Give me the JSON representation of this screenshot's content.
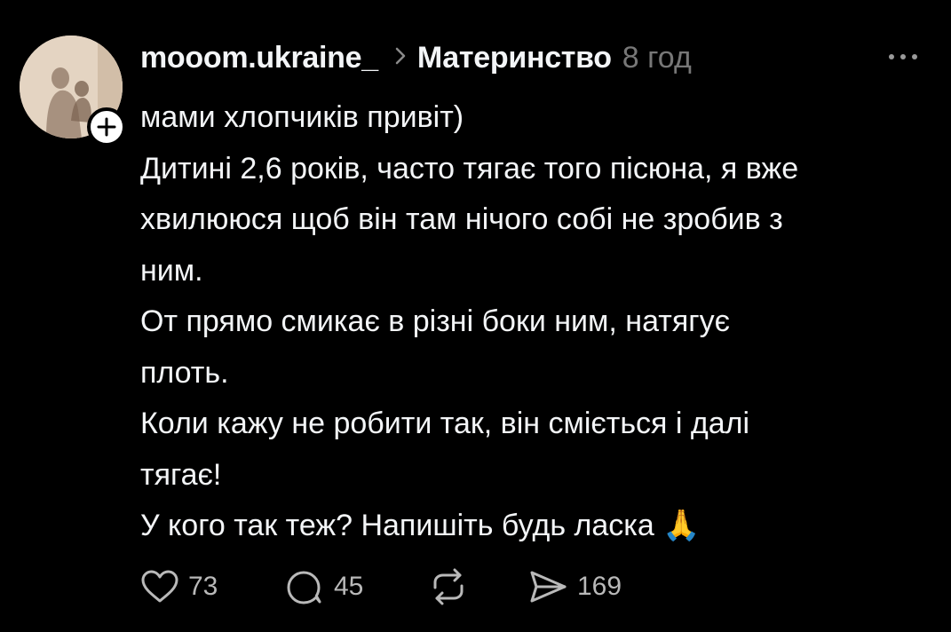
{
  "post": {
    "username": "mooom.ukraine_",
    "topic": "Материнство",
    "time": "8 год",
    "lines": [
      "мами хлопчиків привіт)",
      "Дитині 2,6 років, часто тягає того пісюна, я вже",
      "хвилююся щоб він там нічого собі не зробив з",
      "ним.",
      "От прямо смикає в різні боки ним, натягує",
      "плоть.",
      "Коли кажу не робити так, він сміється і далі",
      "тягає!",
      "У кого так теж? Напишіть будь ласка 🙏"
    ],
    "actions": {
      "likes": "73",
      "replies": "45",
      "shares": "169"
    }
  },
  "icons": {
    "follow": "plus-icon",
    "topic_separator": "chevron-right-icon",
    "more": "more-horizontal-icon",
    "like": "heart-icon",
    "reply": "comment-icon",
    "repost": "repost-icon",
    "share": "send-icon"
  },
  "colors": {
    "background": "#000000",
    "text": "#f3f5f7",
    "muted": "#777777",
    "icon": "#b9b9b9"
  }
}
